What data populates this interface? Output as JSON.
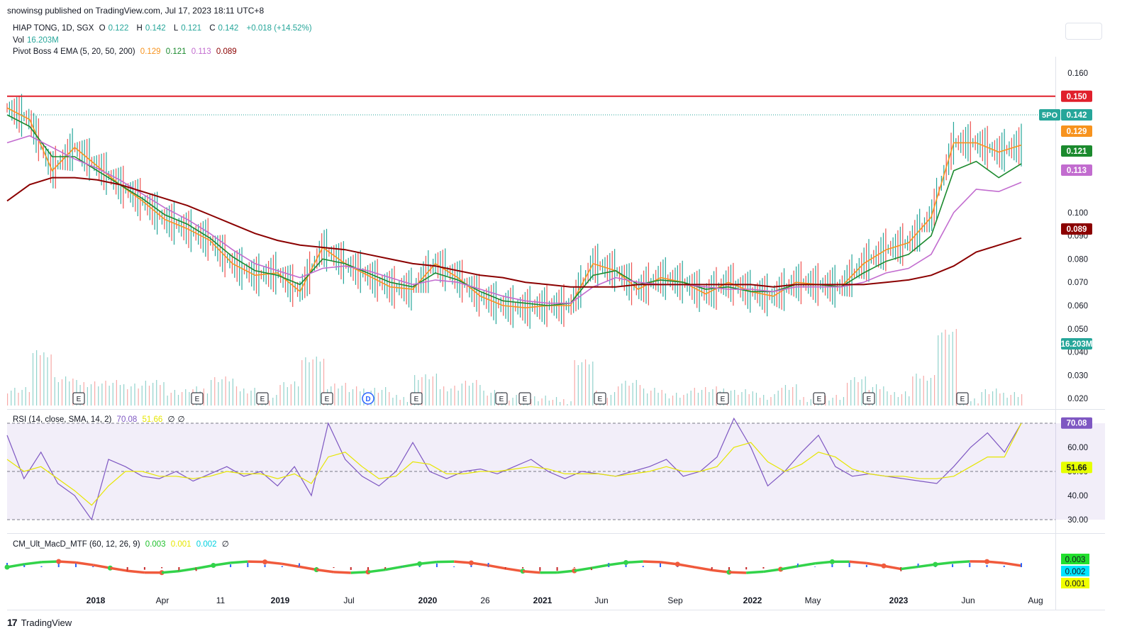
{
  "header": {
    "published": "snowinsg published on TradingView.com, Jul 17, 2023 18:11 UTC+8"
  },
  "legend": {
    "symbol": "HIAP TONG, 1D, SGX",
    "o_label": "O",
    "o_val": "0.122",
    "h_label": "H",
    "h_val": "0.142",
    "l_label": "L",
    "l_val": "0.121",
    "c_label": "C",
    "c_val": "0.142",
    "change": "+0.018 (+14.52%)",
    "vol_label": "Vol",
    "vol_val": "16.203M",
    "ema_label": "Pivot Boss 4 EMA (5, 20, 50, 200)",
    "ema_vals": [
      "0.129",
      "0.121",
      "0.113",
      "0.089"
    ]
  },
  "rsi_legend": {
    "label": "RSI (14, close, SMA, 14, 2)",
    "v1": "70.08",
    "v2": "51.66",
    "v3": "∅",
    "v4": "∅"
  },
  "macd_legend": {
    "label": "CM_Ult_MacD_MTF (60, 12, 26, 9)",
    "v1": "0.003",
    "v2": "0.001",
    "v3": "0.002",
    "v4": "∅"
  },
  "brand": {
    "logo": "17",
    "name": "TradingView"
  },
  "colors": {
    "ema5": "#f7931e",
    "ema20": "#1b8a2e",
    "ema50": "#c26ccf",
    "ema200": "#8b0000",
    "hline": "#e0202c",
    "up": "#26a69a",
    "down": "#ef5350",
    "rsi": "#7e57c2",
    "rsi_ma": "#e6e600"
  },
  "chart_data": {
    "type": "line",
    "title": "HIAP TONG, 1D, SGX",
    "x_tick_labels": [
      "2018",
      "Apr",
      "11",
      "2019",
      "Jul",
      "2020",
      "26",
      "2021",
      "Jun",
      "Sep",
      "2022",
      "May",
      "2023",
      "Jun",
      "Aug"
    ],
    "price_axis": {
      "ticks": [
        "0.160",
        "0.100",
        "0.090",
        "0.080",
        "0.070",
        "0.060",
        "0.050",
        "0.040",
        "0.030",
        "0.020"
      ],
      "range": [
        0.017,
        0.167
      ]
    },
    "horizontal_line": {
      "value": 0.15,
      "label": "0.150"
    },
    "last_price": {
      "value": 0.142,
      "label": "0.142",
      "tag": "5PO"
    },
    "volume_last": "16.203M",
    "event_markers": [
      "E",
      "E",
      "E",
      "E",
      "D",
      "E",
      "E",
      "E",
      "E",
      "E",
      "E",
      "E",
      "E"
    ],
    "series": [
      {
        "name": "EMA 5",
        "last": "0.129",
        "points": [
          0.145,
          0.14,
          0.118,
          0.128,
          0.12,
          0.112,
          0.105,
          0.097,
          0.093,
          0.088,
          0.078,
          0.073,
          0.074,
          0.066,
          0.085,
          0.078,
          0.073,
          0.068,
          0.067,
          0.078,
          0.072,
          0.064,
          0.06,
          0.059,
          0.06,
          0.06,
          0.078,
          0.075,
          0.067,
          0.072,
          0.07,
          0.065,
          0.07,
          0.066,
          0.064,
          0.07,
          0.069,
          0.068,
          0.078,
          0.084,
          0.087,
          0.098,
          0.13,
          0.13,
          0.126,
          0.129
        ]
      },
      {
        "name": "EMA 20",
        "last": "0.121",
        "points": [
          0.142,
          0.137,
          0.124,
          0.124,
          0.118,
          0.112,
          0.106,
          0.099,
          0.095,
          0.089,
          0.081,
          0.075,
          0.073,
          0.069,
          0.08,
          0.078,
          0.074,
          0.07,
          0.068,
          0.074,
          0.071,
          0.066,
          0.062,
          0.061,
          0.06,
          0.061,
          0.073,
          0.075,
          0.069,
          0.071,
          0.07,
          0.067,
          0.068,
          0.066,
          0.066,
          0.069,
          0.069,
          0.068,
          0.074,
          0.079,
          0.082,
          0.09,
          0.118,
          0.122,
          0.115,
          0.121
        ]
      },
      {
        "name": "EMA 50",
        "last": "0.113",
        "points": [
          0.13,
          0.133,
          0.128,
          0.123,
          0.119,
          0.114,
          0.108,
          0.102,
          0.097,
          0.091,
          0.084,
          0.078,
          0.075,
          0.072,
          0.076,
          0.077,
          0.075,
          0.072,
          0.069,
          0.071,
          0.07,
          0.067,
          0.064,
          0.062,
          0.061,
          0.061,
          0.068,
          0.072,
          0.07,
          0.069,
          0.069,
          0.068,
          0.067,
          0.067,
          0.066,
          0.068,
          0.068,
          0.068,
          0.07,
          0.074,
          0.076,
          0.082,
          0.1,
          0.11,
          0.109,
          0.113
        ]
      },
      {
        "name": "EMA 200",
        "last": "0.089",
        "points": [
          0.105,
          0.112,
          0.115,
          0.115,
          0.114,
          0.112,
          0.109,
          0.106,
          0.103,
          0.099,
          0.095,
          0.091,
          0.088,
          0.086,
          0.085,
          0.084,
          0.082,
          0.08,
          0.078,
          0.077,
          0.075,
          0.073,
          0.072,
          0.07,
          0.069,
          0.068,
          0.068,
          0.068,
          0.069,
          0.069,
          0.069,
          0.069,
          0.069,
          0.069,
          0.068,
          0.069,
          0.069,
          0.069,
          0.069,
          0.07,
          0.071,
          0.073,
          0.077,
          0.083,
          0.086,
          0.089
        ]
      }
    ],
    "rsi": {
      "ticks": [
        "70.00",
        "60.00",
        "50.00",
        "40.00",
        "30.00"
      ],
      "upper": 70,
      "lower": 30,
      "last": "70.08",
      "ma_last": "51.66",
      "points": [
        65,
        47,
        58,
        45,
        40,
        30,
        55,
        52,
        48,
        47,
        50,
        46,
        49,
        52,
        48,
        50,
        44,
        52,
        40,
        70,
        55,
        48,
        44,
        50,
        62,
        50,
        47,
        50,
        51,
        49,
        52,
        55,
        50,
        47,
        50,
        49,
        48,
        50,
        52,
        55,
        48,
        50,
        56,
        72,
        60,
        44,
        50,
        58,
        65,
        52,
        48,
        49,
        48,
        47,
        46,
        45,
        52,
        60,
        66,
        58,
        70
      ],
      "ma_points": [
        55,
        50,
        52,
        47,
        42,
        36,
        44,
        50,
        50,
        48,
        48,
        47,
        48,
        50,
        49,
        49,
        47,
        49,
        45,
        56,
        58,
        52,
        47,
        48,
        54,
        53,
        49,
        49,
        50,
        50,
        51,
        52,
        51,
        49,
        49,
        49,
        48,
        49,
        50,
        52,
        50,
        50,
        52,
        60,
        62,
        54,
        50,
        53,
        58,
        56,
        51,
        49,
        48,
        48,
        47,
        47,
        48,
        52,
        56,
        56,
        70
      ]
    },
    "macd": {
      "last_macd": "0.003",
      "last_signal": "0.001",
      "last_hist": "0.002"
    }
  }
}
